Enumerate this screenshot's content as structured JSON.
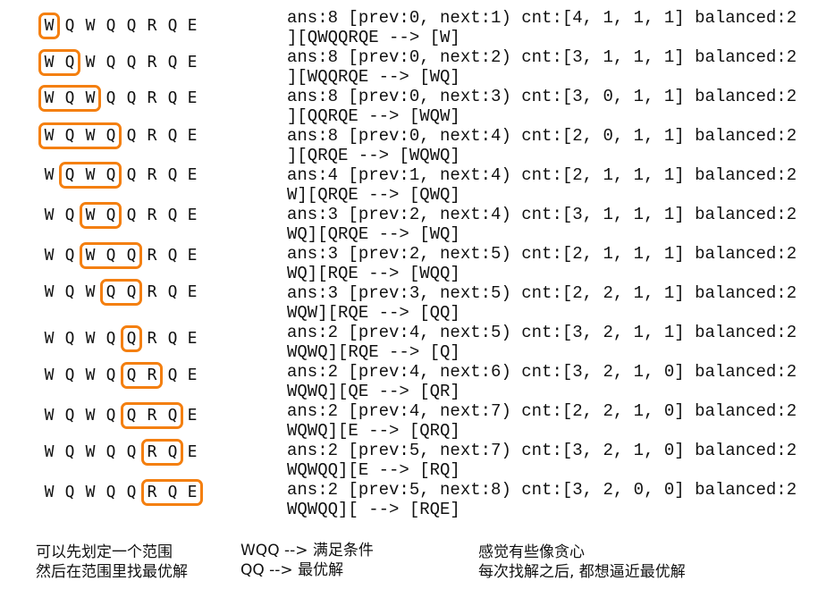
{
  "sequence": [
    "W",
    "Q",
    "W",
    "Q",
    "Q",
    "R",
    "Q",
    "E"
  ],
  "highlight_color": "#f47f0f",
  "steps": [
    {
      "window": [
        0,
        0
      ],
      "line1": "ans:8 [prev:0, next:1) cnt:[4, 1, 1, 1] balanced:2",
      "line2": "][QWQQRQE --> [W]"
    },
    {
      "window": [
        0,
        1
      ],
      "line1": "ans:8 [prev:0, next:2) cnt:[3, 1, 1, 1] balanced:2",
      "line2": "][WQQRQE --> [WQ]"
    },
    {
      "window": [
        0,
        2
      ],
      "line1": "ans:8 [prev:0, next:3) cnt:[3, 0, 1, 1] balanced:2",
      "line2": "][QQRQE --> [WQW]"
    },
    {
      "window": [
        0,
        3
      ],
      "line1": "ans:8 [prev:0, next:4) cnt:[2, 0, 1, 1] balanced:2",
      "line2": "][QRQE --> [WQWQ]"
    },
    {
      "window": [
        1,
        3
      ],
      "line1": "ans:4 [prev:1, next:4) cnt:[2, 1, 1, 1] balanced:2",
      "line2": "W][QRQE --> [QWQ]"
    },
    {
      "window": [
        2,
        3
      ],
      "line1": "ans:3 [prev:2, next:4) cnt:[3, 1, 1, 1] balanced:2",
      "line2": "WQ][QRQE --> [WQ]"
    },
    {
      "window": [
        2,
        4
      ],
      "line1": "ans:3 [prev:2, next:5) cnt:[2, 1, 1, 1] balanced:2",
      "line2": "WQ][RQE --> [WQQ]"
    },
    {
      "window": [
        3,
        4
      ],
      "line1": "ans:3 [prev:3, next:5) cnt:[2, 2, 1, 1] balanced:2",
      "line2": "WQW][RQE --> [QQ]"
    },
    {
      "window": [
        4,
        4
      ],
      "line1": "ans:2 [prev:4, next:5) cnt:[3, 2, 1, 1] balanced:2",
      "line2": "WQWQ][RQE --> [Q]"
    },
    {
      "window": [
        4,
        5
      ],
      "line1": "ans:2 [prev:4, next:6) cnt:[3, 2, 1, 0] balanced:2",
      "line2": "WQWQ][QE --> [QR]"
    },
    {
      "window": [
        4,
        6
      ],
      "line1": "ans:2 [prev:4, next:7) cnt:[2, 2, 1, 0] balanced:2",
      "line2": "WQWQ][E --> [QRQ]"
    },
    {
      "window": [
        5,
        6
      ],
      "line1": "ans:2 [prev:5, next:7) cnt:[3, 2, 1, 0] balanced:2",
      "line2": "WQWQQ][E --> [RQ]"
    },
    {
      "window": [
        5,
        7
      ],
      "line1": "ans:2 [prev:5, next:8) cnt:[3, 2, 0, 0] balanced:2",
      "line2": "WQWQQ][ --> [RQE]"
    }
  ],
  "notes": {
    "left": [
      "可以先划定一个范围",
      "然后在范围里找最优解"
    ],
    "middle": [
      "WQQ --> 满足条件",
      "QQ --> 最优解"
    ],
    "right": [
      "感觉有些像贪心",
      "每次找解之后, 都想逼近最优解"
    ]
  }
}
